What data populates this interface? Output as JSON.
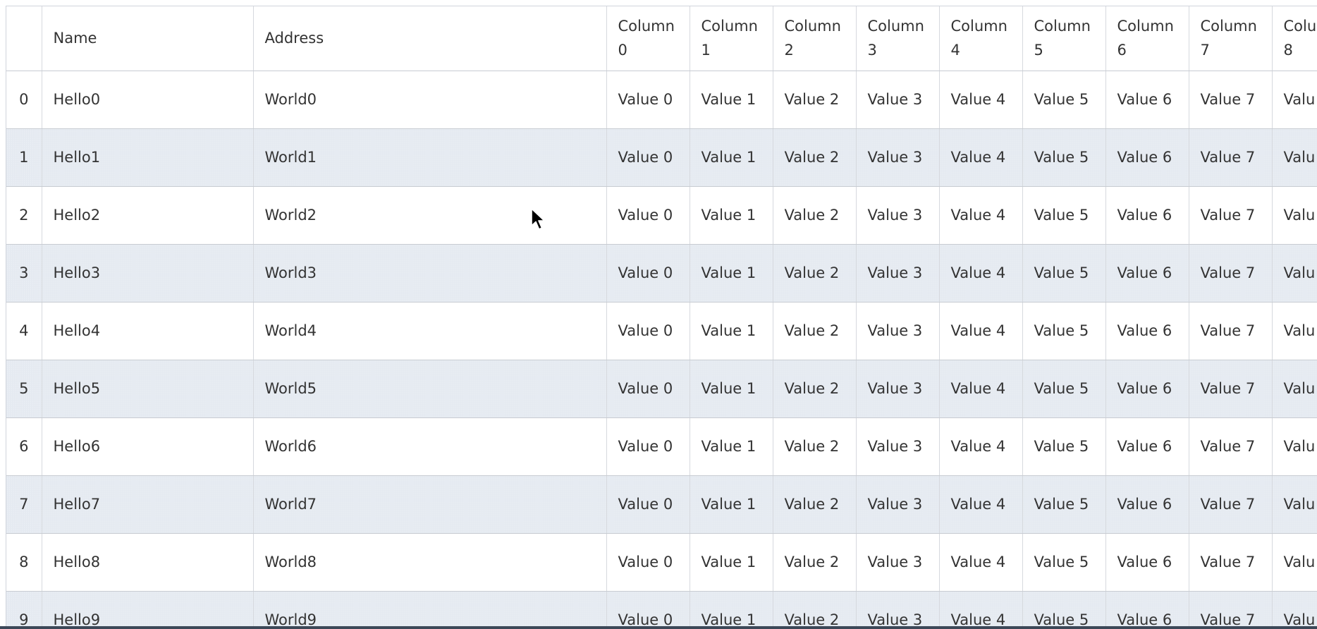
{
  "grid": {
    "index_header": "",
    "headers": [
      "Name",
      "Address"
    ],
    "value_columns": [
      {
        "word": "Column",
        "num": "0"
      },
      {
        "word": "Column",
        "num": "1"
      },
      {
        "word": "Column",
        "num": "2"
      },
      {
        "word": "Column",
        "num": "3"
      },
      {
        "word": "Column",
        "num": "4"
      },
      {
        "word": "Column",
        "num": "5"
      },
      {
        "word": "Column",
        "num": "6"
      },
      {
        "word": "Column",
        "num": "7"
      },
      {
        "word": "Colu",
        "num": "8"
      }
    ],
    "rows": [
      {
        "index": "0",
        "name": "Hello0",
        "address": "World0",
        "values": [
          "Value 0",
          "Value 1",
          "Value 2",
          "Value 3",
          "Value 4",
          "Value 5",
          "Value 6",
          "Value 7",
          "Valu"
        ]
      },
      {
        "index": "1",
        "name": "Hello1",
        "address": "World1",
        "values": [
          "Value 0",
          "Value 1",
          "Value 2",
          "Value 3",
          "Value 4",
          "Value 5",
          "Value 6",
          "Value 7",
          "Valu"
        ]
      },
      {
        "index": "2",
        "name": "Hello2",
        "address": "World2",
        "values": [
          "Value 0",
          "Value 1",
          "Value 2",
          "Value 3",
          "Value 4",
          "Value 5",
          "Value 6",
          "Value 7",
          "Valu"
        ]
      },
      {
        "index": "3",
        "name": "Hello3",
        "address": "World3",
        "values": [
          "Value 0",
          "Value 1",
          "Value 2",
          "Value 3",
          "Value 4",
          "Value 5",
          "Value 6",
          "Value 7",
          "Valu"
        ]
      },
      {
        "index": "4",
        "name": "Hello4",
        "address": "World4",
        "values": [
          "Value 0",
          "Value 1",
          "Value 2",
          "Value 3",
          "Value 4",
          "Value 5",
          "Value 6",
          "Value 7",
          "Valu"
        ]
      },
      {
        "index": "5",
        "name": "Hello5",
        "address": "World5",
        "values": [
          "Value 0",
          "Value 1",
          "Value 2",
          "Value 3",
          "Value 4",
          "Value 5",
          "Value 6",
          "Value 7",
          "Valu"
        ]
      },
      {
        "index": "6",
        "name": "Hello6",
        "address": "World6",
        "values": [
          "Value 0",
          "Value 1",
          "Value 2",
          "Value 3",
          "Value 4",
          "Value 5",
          "Value 6",
          "Value 7",
          "Valu"
        ]
      },
      {
        "index": "7",
        "name": "Hello7",
        "address": "World7",
        "values": [
          "Value 0",
          "Value 1",
          "Value 2",
          "Value 3",
          "Value 4",
          "Value 5",
          "Value 6",
          "Value 7",
          "Valu"
        ]
      },
      {
        "index": "8",
        "name": "Hello8",
        "address": "World8",
        "values": [
          "Value 0",
          "Value 1",
          "Value 2",
          "Value 3",
          "Value 4",
          "Value 5",
          "Value 6",
          "Value 7",
          "Valu"
        ]
      },
      {
        "index": "9",
        "name": "Hello9",
        "address": "World9",
        "values": [
          "Value 0",
          "Value 1",
          "Value 2",
          "Value 3",
          "Value 4",
          "Value 5",
          "Value 6",
          "Value 7",
          "Valu"
        ]
      }
    ]
  },
  "colors": {
    "row_stripe": "#e5eaf1",
    "grid_line": "#d6d9de",
    "text": "#333333"
  },
  "icons": {
    "pointer": "mouse-pointer-icon"
  }
}
